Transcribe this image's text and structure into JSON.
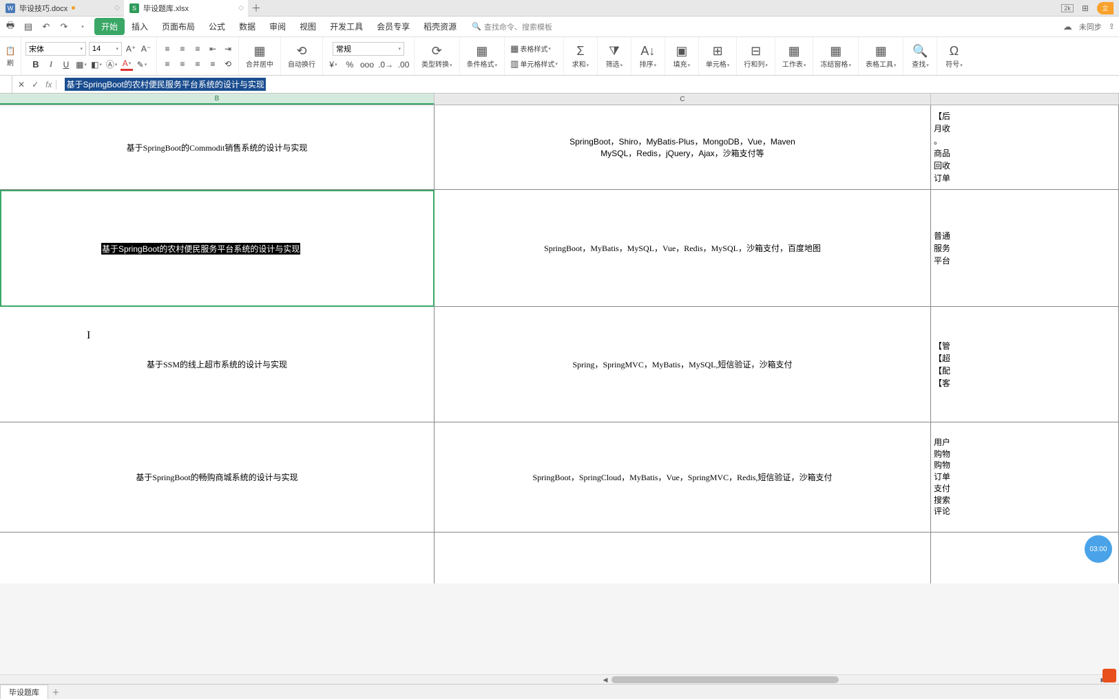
{
  "tabs": {
    "doc": {
      "label": "毕设技巧.docx"
    },
    "xls": {
      "label": "毕设题库.xlsx"
    }
  },
  "titlebar": {
    "badge_2k": "2k"
  },
  "menu": {
    "start": "开始",
    "insert": "插入",
    "layout": "页面布局",
    "formula": "公式",
    "data": "数据",
    "review": "审阅",
    "view": "视图",
    "dev": "开发工具",
    "member": "会员专享",
    "res": "稻壳资源",
    "search_placeholder": "查找命令、搜索模板",
    "unsync": "未同步"
  },
  "ribbon": {
    "font_name": "宋体",
    "font_size": "14",
    "merge": "合并居中",
    "wrap": "自动换行",
    "num_format": "常规",
    "type_conv": "类型转换",
    "cond_fmt": "条件格式",
    "table_style": "表格样式",
    "cell_style": "单元格样式",
    "sum": "求和",
    "filter": "筛选",
    "sort": "排序",
    "fill": "填充",
    "cell": "单元格",
    "rowcol": "行和列",
    "sheet": "工作表",
    "freeze": "冻结窗格",
    "tabletool": "表格工具",
    "find": "查找",
    "symbol": "符号"
  },
  "formula_bar": {
    "content": "基于SpringBoot的农村便民服务平台系统的设计与实现"
  },
  "columns": {
    "b": "B",
    "c": "C"
  },
  "cells": {
    "b1": "基于SpringBoot的Commodit销售系统的设计与实现",
    "c1a": "SpringBoot，Shiro，MyBatis-Plus，MongoDB，Vue，Maven",
    "c1b": "MySQL，Redis，jQuery，Ajax，沙箱支付等",
    "d1": "【后\n月收\n。\n商品\n回收\n订单",
    "b2": "基于SpringBoot的农村便民服务平台系统的设计与实现",
    "c2": "SpringBoot，MyBatis，MySQL，Vue，Redis，MySQL，沙箱支付，百度地图",
    "d2": "普通\n服务\n平台",
    "b3": "基于SSM的线上超市系统的设计与实现",
    "c3": "Spring，SpringMVC，MyBatis，MySQL,短信验证，沙箱支付",
    "d3": "【管\n【超\n【配\n【客",
    "b4": "基于SpringBoot的畅购商城系统的设计与实现",
    "c4": "SpringBoot，SpringCloud，MyBatis，Vue，SpringMVC，Redis,短信验证，沙箱支付",
    "d4": "用户\n购物\n购物\n订单\n支付\n搜索\n评论"
  },
  "sheet": {
    "name": "毕设题库"
  },
  "timer": "03:00"
}
